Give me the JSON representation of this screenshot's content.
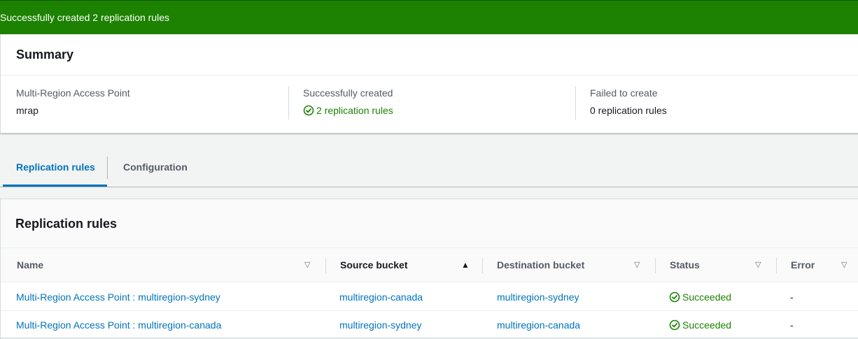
{
  "flash": {
    "message": "Successfully created 2 replication rules"
  },
  "summary": {
    "title": "Summary",
    "columns": [
      {
        "label": "Multi-Region Access Point",
        "value": "mrap"
      },
      {
        "label": "Successfully created",
        "value": "2 replication rules",
        "icon": "check-circle-icon"
      },
      {
        "label": "Failed to create",
        "value": "0 replication rules"
      }
    ]
  },
  "tabs": [
    {
      "label": "Replication rules",
      "active": true
    },
    {
      "label": "Configuration",
      "active": false
    }
  ],
  "rules": {
    "title": "Replication rules",
    "columns": [
      "Name",
      "Source bucket",
      "Destination bucket",
      "Status",
      "Error"
    ],
    "sort": {
      "column": "Source bucket",
      "direction": "ascending"
    },
    "rows": [
      {
        "name": "Multi-Region Access Point : multiregion-sydney",
        "source": "multiregion-canada",
        "destination": "multiregion-sydney",
        "status": "Succeeded",
        "error": "-"
      },
      {
        "name": "Multi-Region Access Point : multiregion-canada",
        "source": "multiregion-sydney",
        "destination": "multiregion-canada",
        "status": "Succeeded",
        "error": "-"
      }
    ]
  },
  "colors": {
    "success": "#1d8102",
    "link": "#0073bb",
    "flash_bg": "#1d8102"
  }
}
